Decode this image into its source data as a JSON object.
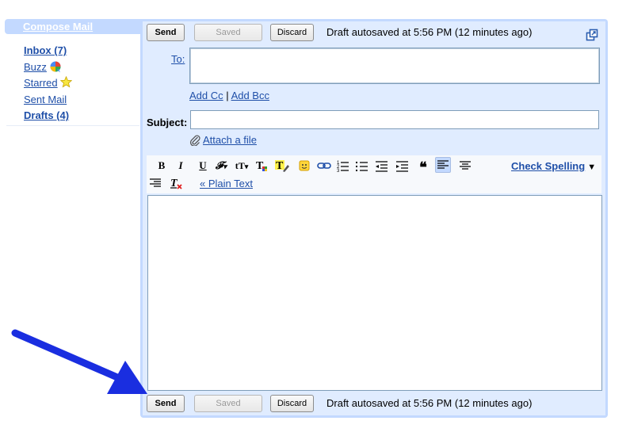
{
  "sidebar": {
    "compose_label": "Compose Mail",
    "items": [
      {
        "label": "Inbox (7)",
        "bold": true
      },
      {
        "label": "Buzz",
        "icon": "buzz-icon"
      },
      {
        "label": "Starred",
        "icon": "star-icon"
      },
      {
        "label": "Sent Mail"
      },
      {
        "label": "Drafts (4)",
        "bold": true
      }
    ]
  },
  "actions": {
    "send_label": "Send",
    "saved_label": "Saved",
    "discard_label": "Discard",
    "status": "Draft autosaved at 5:56 PM (12 minutes ago)"
  },
  "compose": {
    "to_label": "To:",
    "to_value": "",
    "add_cc": "Add Cc",
    "separator": "|",
    "add_bcc": "Add Bcc",
    "subject_label": "Subject:",
    "subject_value": "",
    "attach_label": "Attach a file",
    "body_value": ""
  },
  "toolbar": {
    "buttons": [
      {
        "name": "bold-icon",
        "glyph": "B"
      },
      {
        "name": "italic-icon",
        "glyph": "I"
      },
      {
        "name": "underline-icon",
        "glyph": "U"
      },
      {
        "name": "font-icon",
        "glyph": "F"
      },
      {
        "name": "font-size-icon",
        "glyph": "tT"
      },
      {
        "name": "text-color-icon",
        "glyph": "T"
      },
      {
        "name": "highlight-icon",
        "glyph": "T"
      },
      {
        "name": "emoticon-icon",
        "glyph": "☺"
      },
      {
        "name": "link-icon",
        "glyph": "∞"
      },
      {
        "name": "numbered-list-icon",
        "glyph": "≡"
      },
      {
        "name": "bulleted-list-icon",
        "glyph": "≡"
      },
      {
        "name": "outdent-icon",
        "glyph": "⇤"
      },
      {
        "name": "indent-icon",
        "glyph": "⇥"
      },
      {
        "name": "quote-icon",
        "glyph": "❝"
      },
      {
        "name": "align-left-icon",
        "glyph": "≡"
      },
      {
        "name": "align-center-icon",
        "glyph": "≡"
      },
      {
        "name": "align-right-icon",
        "glyph": "≡"
      },
      {
        "name": "remove-formatting-icon",
        "glyph": "T"
      }
    ],
    "check_spelling": "Check Spelling",
    "check_spelling_arrow": "▼",
    "plain_text": "« Plain Text"
  },
  "colors": {
    "panel_border": "#c3d9ff",
    "panel_bg": "#e0ecff",
    "link": "#1f4fa8",
    "annotation_arrow": "#1a2ee0"
  }
}
